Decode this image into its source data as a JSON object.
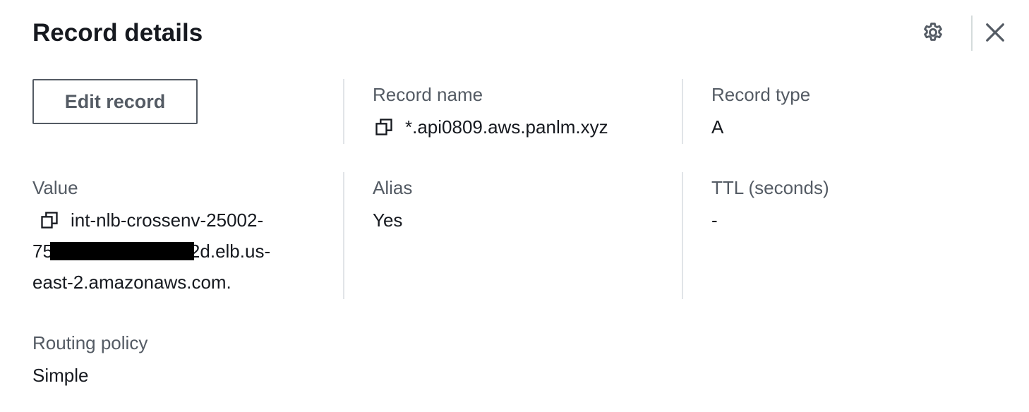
{
  "panel": {
    "title": "Record details"
  },
  "actions": {
    "edit_label": "Edit record",
    "settings_icon": "gear-icon",
    "close_icon": "close-icon"
  },
  "fields": {
    "record_name": {
      "label": "Record name",
      "value": "*.api0809.aws.panlm.xyz"
    },
    "record_type": {
      "label": "Record type",
      "value": "A"
    },
    "value": {
      "label": "Value",
      "line1": "int-nlb-crossenv-25002-",
      "line2_prefix": "75",
      "line2_suffix": "2d.elb.us-",
      "line3": "east-2.amazonaws.com."
    },
    "alias": {
      "label": "Alias",
      "value": "Yes"
    },
    "ttl": {
      "label": "TTL (seconds)",
      "value": "-"
    },
    "routing_policy": {
      "label": "Routing policy",
      "value": "Simple"
    }
  },
  "colors": {
    "text": "#16191f",
    "label": "#545b64",
    "divider": "#e1e4e8"
  }
}
